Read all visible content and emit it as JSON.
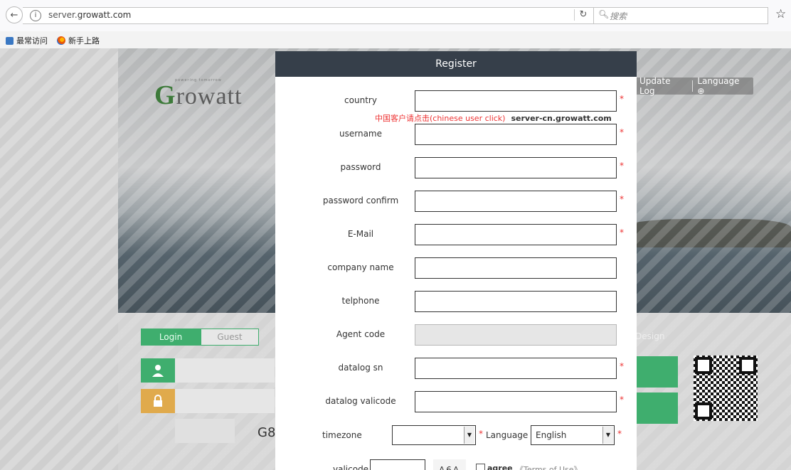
{
  "browser": {
    "url_host": "server.",
    "url_domain": "growatt.com",
    "search_placeholder": "搜索",
    "bookmarks": [
      "最常访问",
      "新手上路"
    ]
  },
  "site": {
    "logo_g": "G",
    "logo_rest": "rowatt",
    "tagline": "powering tomorrow",
    "update_log": "Update Log",
    "language": "Language",
    "tab_login": "Login",
    "tab_guest": "Guest",
    "design": "Design",
    "g8_text": "G8"
  },
  "modal": {
    "title": "Register",
    "cn_note": "中国客户请点击(chinese user click)",
    "cn_link": "server-cn.growatt.com",
    "fields": [
      {
        "label": "country",
        "required": "*"
      },
      {
        "label": "username",
        "required": "*"
      },
      {
        "label": "password",
        "required": "*"
      },
      {
        "label": "password confirm",
        "required": "*"
      },
      {
        "label": "E-Mail",
        "required": "*"
      },
      {
        "label": "company name",
        "required": ""
      },
      {
        "label": "telphone",
        "required": ""
      },
      {
        "label": "Agent code",
        "required": ""
      },
      {
        "label": "datalog sn",
        "required": "*"
      },
      {
        "label": "datalog valicode",
        "required": "*"
      }
    ],
    "timezone_label": "timezone",
    "timezone_value": "",
    "language_label": "Language",
    "language_value": "English",
    "required_mark": "*",
    "valicode_label": "valicode",
    "valicode_image_text": "A6A",
    "agree_label": "agree",
    "terms_link": "《Terms of Use》"
  }
}
